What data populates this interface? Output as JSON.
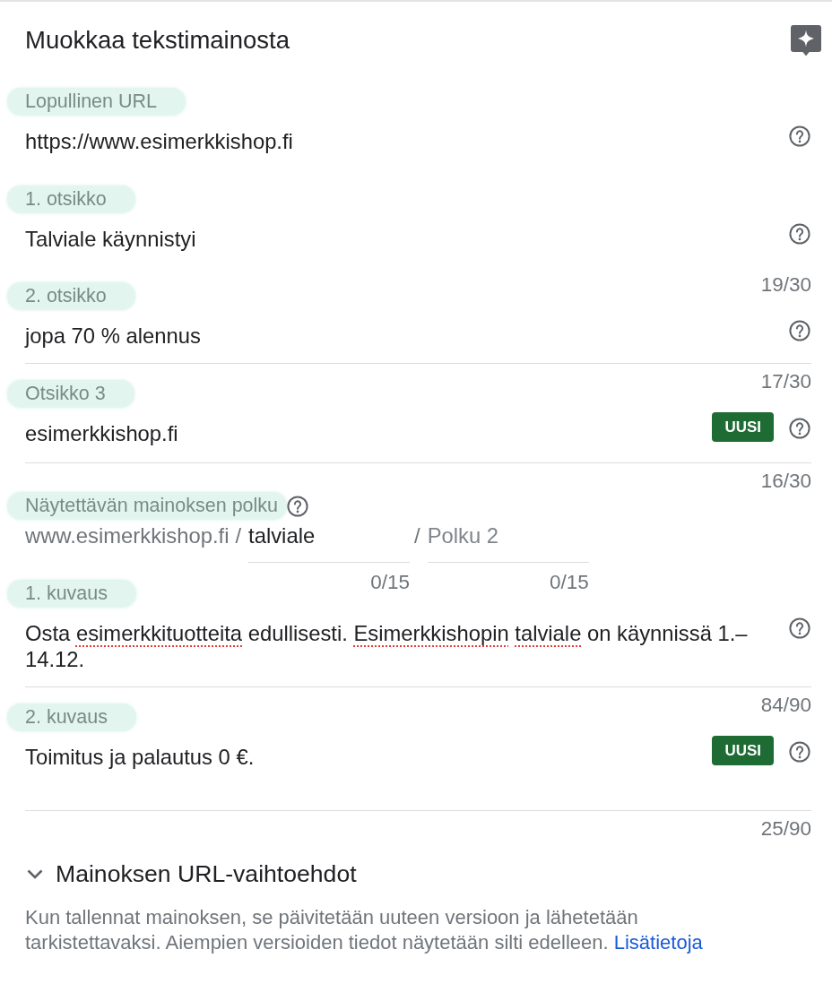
{
  "title": "Muokkaa tekstimainosta",
  "fields": [
    {
      "kind": "input",
      "label": "Lopullinen URL",
      "value": [
        {
          "text": "https://www.esimerkkishop.fi",
          "misspelled": false
        }
      ],
      "underlined": false
    },
    {
      "kind": "input",
      "label": "1. otsikko",
      "value": [
        {
          "text": "Talviale käynnistyi",
          "misspelled": false
        }
      ],
      "underlined": false,
      "counter": "19/30"
    },
    {
      "kind": "input",
      "label": "2. otsikko",
      "value": [
        {
          "text": "jopa 70 % alennus",
          "misspelled": false
        }
      ],
      "underlined": true,
      "counter": "17/30"
    },
    {
      "kind": "input",
      "label": "Otsikko 3",
      "value": [
        {
          "text": "esimerkkishop.fi",
          "misspelled": false
        }
      ],
      "badge": "UUSI",
      "underlined": true,
      "counter": "16/30"
    },
    {
      "kind": "path",
      "label": "Näytettävän mainoksen polku",
      "domain": "www.esimerkkishop.fi",
      "parts": [
        {
          "separator": "/",
          "value": "talviale",
          "counter": "0/15"
        },
        {
          "separator": "/",
          "placeholder": "Polku 2",
          "counter": "0/15"
        }
      ]
    },
    {
      "kind": "textarea",
      "label": "1. kuvaus",
      "value": [
        {
          "text": "Osta",
          "misspelled": false
        },
        {
          "text": "esimerkkituotteita",
          "misspelled": true
        },
        {
          "text": "edullisesti.",
          "misspelled": false
        },
        {
          "text": "Esimerkkishopin",
          "misspelled": true
        },
        {
          "text": "talviale",
          "misspelled": true
        },
        {
          "text": "on käynnissä 1.–14.12.",
          "misspelled": false
        }
      ],
      "underlined": true,
      "counter": "84/90"
    },
    {
      "kind": "textarea",
      "label": "2. kuvaus",
      "value": [
        {
          "text": "Toimitus ja palautus 0 €.",
          "misspelled": false
        }
      ],
      "badge": "UUSI",
      "underlined": true,
      "counter": "25/90"
    }
  ],
  "url_options": {
    "label": "Mainoksen URL-vaihtoehdot",
    "expanded": false
  },
  "notice": {
    "text": "Kun tallennat mainoksen, se päivitetään uuteen versioon ja lähetetään tarkistettavaksi. Aiempien versioiden tiedot näytetään silti edelleen.",
    "link": "Lisätietoja"
  }
}
